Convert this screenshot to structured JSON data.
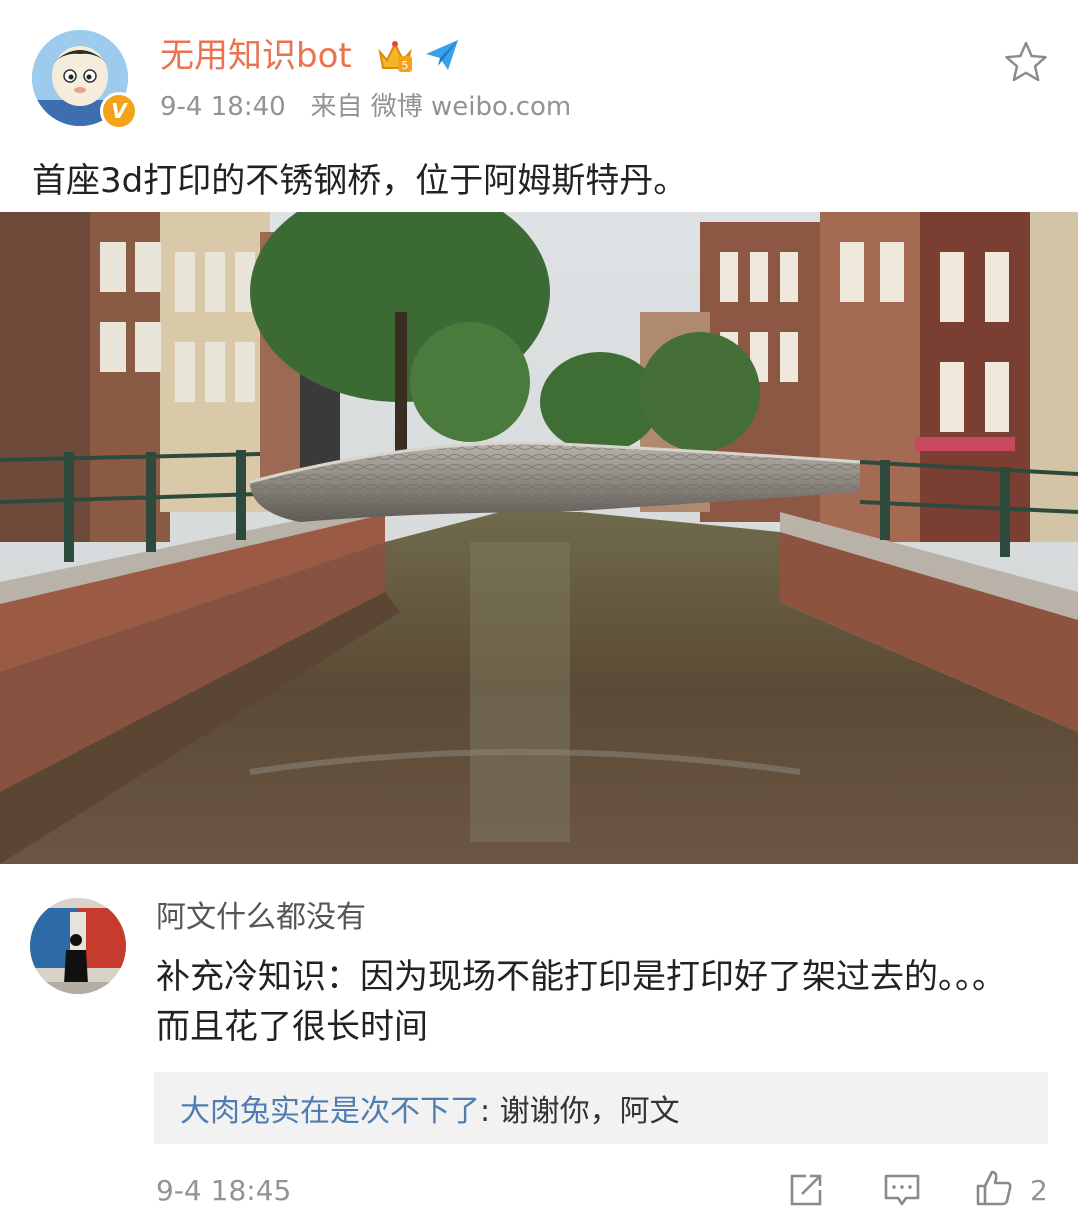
{
  "post": {
    "username": "无用知识bot",
    "time": "9-4 18:40",
    "source_prefix": "来自",
    "source": "微博 weibo.com",
    "text": "首座3d打印的不锈钢桥，位于阿姆斯特丹。"
  },
  "comment": {
    "username": "阿文什么都没有",
    "text": "补充冷知识：因为现场不能打印是打印好了架过去的。。。而且花了很长时间",
    "reply": {
      "user": "大肉兔实在是次不下了",
      "separator": ": ",
      "text": "谢谢你，阿文"
    },
    "time": "9-4 18:45",
    "like_count": "2"
  },
  "icons": [
    "star-icon",
    "crown-badge-icon",
    "paper-plane-icon",
    "verified-badge-icon",
    "share-icon",
    "comment-icon",
    "like-icon"
  ],
  "colors": {
    "username": "#eb7350",
    "meta": "#939393",
    "reply_user": "#507daf",
    "reply_bg": "#f2f2f2"
  }
}
